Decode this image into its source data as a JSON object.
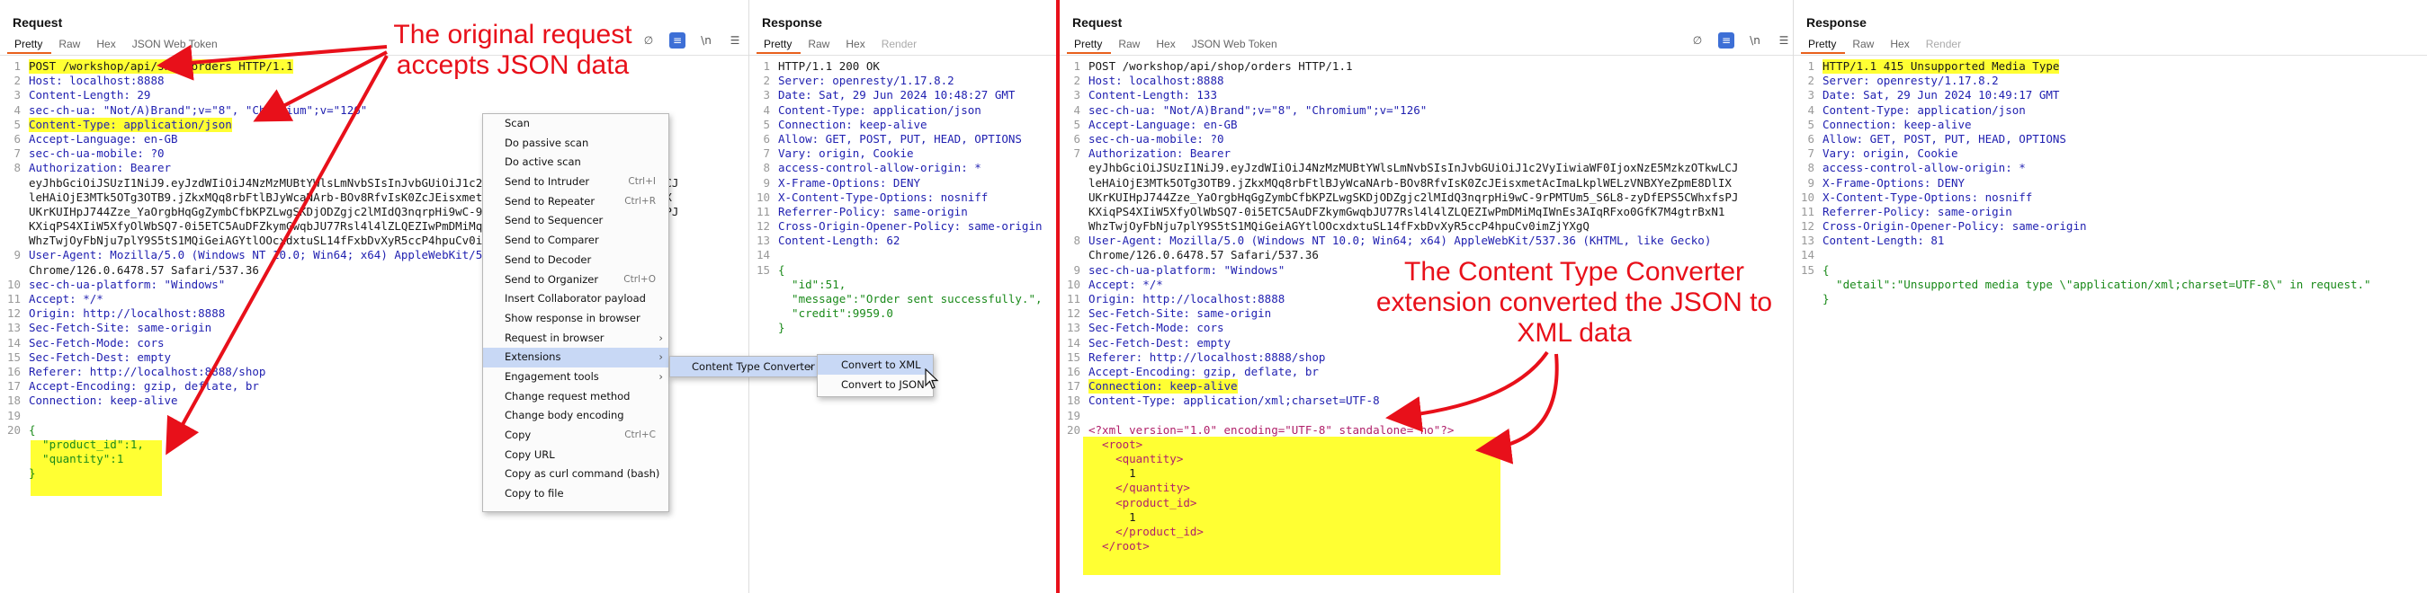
{
  "tabs": [
    "Pretty",
    "Raw",
    "Hex",
    "JSON Web Token"
  ],
  "tabs_short": [
    "Pretty",
    "Raw",
    "Hex",
    "Render"
  ],
  "left_request": {
    "title": "Request",
    "lines": [
      {
        "n": "1",
        "t": "POST /workshop/api/shop/orders HTTP/1.1"
      },
      {
        "n": "2",
        "t": "Host: localhost:8888"
      },
      {
        "n": "3",
        "t": "Content-Length: 29"
      },
      {
        "n": "4",
        "t": "sec-ch-ua: \"Not/A)Brand\";v=\"8\", \"Chromium\";v=\"126\""
      },
      {
        "n": "5",
        "t": "Content-Type: application/json"
      },
      {
        "n": "6",
        "t": "Accept-Language: en-GB"
      },
      {
        "n": "7",
        "t": "sec-ch-ua-mobile: ?0"
      },
      {
        "n": "8",
        "t": "Authorization: Bearer"
      },
      {
        "n": "",
        "t": "eyJhbGciOiJSUzI1NiJ9.eyJzdWIiOiJ4NzMzMUBtYWlsLmNvbSIsInJvbGUiOiJ1c2VyIiwiaWF0IjoxNzE5MzkzOTkwLCJ"
      },
      {
        "n": "",
        "t": "leHAiOjE3MTk5OTg3OTB9.jZkxMQq8rbFtlBJyWcaNArb-BOv8RfvIsK0ZcJEisxmetAcImaLkplWELzVNBXYeZpmE8DlIX"
      },
      {
        "n": "",
        "t": "UKrKUIHpJ744Zze_YaOrgbHqGgZymbCfbKPZLwgSKDjODZgjc2lMIdQ3nqrpHi9wC-9rPMTUm5_S6L8-zyDfEPS5CWhxfsPJ"
      },
      {
        "n": "",
        "t": "KXiqPS4XIiW5XfyOlWbSQ7-0i5ETC5AuDFZkymGwqbJU77Rsl4l4lZLQEZIwPmDMiMqIWnEs3AIqRFxo0GfK7M4gtrBxN1"
      },
      {
        "n": "",
        "t": "WhzTwjOyFbNju7plY9S5tS1MQiGeiAGYtlOOcxdxtuSL14fFxbDvXyR5ccP4hpuCv0imZjYXgQ"
      },
      {
        "n": "9",
        "t": "User-Agent: Mozilla/5.0 (Windows NT 10.0; Win64; x64) AppleWebKit/537.36 (KHTML, like Gecko)"
      },
      {
        "n": "",
        "t": "Chrome/126.0.6478.57 Safari/537.36"
      },
      {
        "n": "10",
        "t": "sec-ch-ua-platform: \"Windows\""
      },
      {
        "n": "11",
        "t": "Accept: */*"
      },
      {
        "n": "12",
        "t": "Origin: http://localhost:8888"
      },
      {
        "n": "13",
        "t": "Sec-Fetch-Site: same-origin"
      },
      {
        "n": "14",
        "t": "Sec-Fetch-Mode: cors"
      },
      {
        "n": "15",
        "t": "Sec-Fetch-Dest: empty"
      },
      {
        "n": "16",
        "t": "Referer: http://localhost:8888/shop"
      },
      {
        "n": "17",
        "t": "Accept-Encoding: gzip, deflate, br"
      },
      {
        "n": "18",
        "t": "Connection: keep-alive"
      },
      {
        "n": "19",
        "t": ""
      },
      {
        "n": "20",
        "t": "{"
      },
      {
        "n": "",
        "t": "  \"product_id\":1,"
      },
      {
        "n": "",
        "t": "  \"quantity\":1"
      },
      {
        "n": "",
        "t": "}"
      }
    ]
  },
  "left_response": {
    "title": "Response",
    "lines": [
      {
        "n": "1",
        "t": "HTTP/1.1 200 OK"
      },
      {
        "n": "2",
        "t": "Server: openresty/1.17.8.2"
      },
      {
        "n": "3",
        "t": "Date: Sat, 29 Jun 2024 10:48:27 GMT"
      },
      {
        "n": "4",
        "t": "Content-Type: application/json"
      },
      {
        "n": "5",
        "t": "Connection: keep-alive"
      },
      {
        "n": "6",
        "t": "Allow: GET, POST, PUT, HEAD, OPTIONS"
      },
      {
        "n": "7",
        "t": "Vary: origin, Cookie"
      },
      {
        "n": "8",
        "t": "access-control-allow-origin: *"
      },
      {
        "n": "9",
        "t": "X-Frame-Options: DENY"
      },
      {
        "n": "10",
        "t": "X-Content-Type-Options: nosniff"
      },
      {
        "n": "11",
        "t": "Referrer-Policy: same-origin"
      },
      {
        "n": "12",
        "t": "Cross-Origin-Opener-Policy: same-origin"
      },
      {
        "n": "13",
        "t": "Content-Length: 62"
      },
      {
        "n": "14",
        "t": ""
      },
      {
        "n": "15",
        "t": "{"
      },
      {
        "n": "",
        "t": "  \"id\":51,"
      },
      {
        "n": "",
        "t": "  \"message\":\"Order sent successfully.\","
      },
      {
        "n": "",
        "t": "  \"credit\":9959.0"
      },
      {
        "n": "",
        "t": "}"
      }
    ]
  },
  "right_request": {
    "title": "Request",
    "lines": [
      {
        "n": "1",
        "t": "POST /workshop/api/shop/orders HTTP/1.1"
      },
      {
        "n": "2",
        "t": "Host: localhost:8888"
      },
      {
        "n": "3",
        "t": "Content-Length: 133"
      },
      {
        "n": "4",
        "t": "sec-ch-ua: \"Not/A)Brand\";v=\"8\", \"Chromium\";v=\"126\""
      },
      {
        "n": "5",
        "t": "Accept-Language: en-GB"
      },
      {
        "n": "6",
        "t": "sec-ch-ua-mobile: ?0"
      },
      {
        "n": "7",
        "t": "Authorization: Bearer"
      },
      {
        "n": "",
        "t": "eyJhbGciOiJSUzI1NiJ9.eyJzdWIiOiJ4NzMzMUBtYWlsLmNvbSIsInJvbGUiOiJ1c2VyIiwiaWF0IjoxNzE5MzkzOTkwLCJ"
      },
      {
        "n": "",
        "t": "leHAiOjE3MTk5OTg3OTB9.jZkxMQq8rbFtlBJyWcaNArb-BOv8RfvIsK0ZcJEisxmetAcImaLkplWELzVNBXYeZpmE8DlIX"
      },
      {
        "n": "",
        "t": "UKrKUIHpJ744Zze_YaOrgbHqGgZymbCfbKPZLwgSKDjODZgjc2lMIdQ3nqrpHi9wC-9rPMTUm5_S6L8-zyDfEPS5CWhxfsPJ"
      },
      {
        "n": "",
        "t": "KXiqPS4XIiW5XfyOlWbSQ7-0i5ETC5AuDFZkymGwqbJU77Rsl4l4lZLQEZIwPmDMiMqIWnEs3AIqRFxo0GfK7M4gtrBxN1"
      },
      {
        "n": "",
        "t": "WhzTwjOyFbNju7plY9S5tS1MQiGeiAGYtlOOcxdxtuSL14fFxbDvXyR5ccP4hpuCv0imZjYXgQ"
      },
      {
        "n": "8",
        "t": "User-Agent: Mozilla/5.0 (Windows NT 10.0; Win64; x64) AppleWebKit/537.36 (KHTML, like Gecko)"
      },
      {
        "n": "",
        "t": "Chrome/126.0.6478.57 Safari/537.36"
      },
      {
        "n": "9",
        "t": "sec-ch-ua-platform: \"Windows\""
      },
      {
        "n": "10",
        "t": "Accept: */*"
      },
      {
        "n": "11",
        "t": "Origin: http://localhost:8888"
      },
      {
        "n": "12",
        "t": "Sec-Fetch-Site: same-origin"
      },
      {
        "n": "13",
        "t": "Sec-Fetch-Mode: cors"
      },
      {
        "n": "14",
        "t": "Sec-Fetch-Dest: empty"
      },
      {
        "n": "15",
        "t": "Referer: http://localhost:8888/shop"
      },
      {
        "n": "16",
        "t": "Accept-Encoding: gzip, deflate, br"
      },
      {
        "n": "17",
        "t": "Connection: keep-alive"
      },
      {
        "n": "18",
        "t": "Content-Type: application/xml;charset=UTF-8"
      },
      {
        "n": "19",
        "t": ""
      },
      {
        "n": "20",
        "t": "<?xml version=\"1.0\" encoding=\"UTF-8\" standalone=\"no\"?>"
      },
      {
        "n": "",
        "t": "  <root>"
      },
      {
        "n": "",
        "t": "    <quantity>"
      },
      {
        "n": "",
        "t": "      1"
      },
      {
        "n": "",
        "t": "    </quantity>"
      },
      {
        "n": "",
        "t": "    <product_id>"
      },
      {
        "n": "",
        "t": "      1"
      },
      {
        "n": "",
        "t": "    </product_id>"
      },
      {
        "n": "",
        "t": "  </root>"
      }
    ]
  },
  "right_response": {
    "title": "Response",
    "lines": [
      {
        "n": "1",
        "t": "HTTP/1.1 415 Unsupported Media Type"
      },
      {
        "n": "2",
        "t": "Server: openresty/1.17.8.2"
      },
      {
        "n": "3",
        "t": "Date: Sat, 29 Jun 2024 10:49:17 GMT"
      },
      {
        "n": "4",
        "t": "Content-Type: application/json"
      },
      {
        "n": "5",
        "t": "Connection: keep-alive"
      },
      {
        "n": "6",
        "t": "Allow: GET, POST, PUT, HEAD, OPTIONS"
      },
      {
        "n": "7",
        "t": "Vary: origin, Cookie"
      },
      {
        "n": "8",
        "t": "access-control-allow-origin: *"
      },
      {
        "n": "9",
        "t": "X-Frame-Options: DENY"
      },
      {
        "n": "10",
        "t": "X-Content-Type-Options: nosniff"
      },
      {
        "n": "11",
        "t": "Referrer-Policy: same-origin"
      },
      {
        "n": "12",
        "t": "Cross-Origin-Opener-Policy: same-origin"
      },
      {
        "n": "13",
        "t": "Content-Length: 81"
      },
      {
        "n": "14",
        "t": ""
      },
      {
        "n": "15",
        "t": "{"
      },
      {
        "n": "",
        "t": "  \"detail\":\"Unsupported media type \\\"application/xml;charset=UTF-8\\\" in request.\""
      },
      {
        "n": "",
        "t": "}"
      }
    ]
  },
  "context_menu": {
    "items": [
      {
        "label": "Scan",
        "shortcut": "",
        "sub": false
      },
      {
        "label": "Do passive scan",
        "shortcut": "",
        "sub": false
      },
      {
        "label": "Do active scan",
        "shortcut": "",
        "sub": false
      },
      {
        "label": "Send to Intruder",
        "shortcut": "Ctrl+I",
        "sub": false
      },
      {
        "label": "Send to Repeater",
        "shortcut": "Ctrl+R",
        "sub": false
      },
      {
        "label": "Send to Sequencer",
        "shortcut": "",
        "sub": false
      },
      {
        "label": "Send to Comparer",
        "shortcut": "",
        "sub": false
      },
      {
        "label": "Send to Decoder",
        "shortcut": "",
        "sub": false
      },
      {
        "label": "Send to Organizer",
        "shortcut": "Ctrl+O",
        "sub": false
      },
      {
        "label": "Insert Collaborator payload",
        "shortcut": "",
        "sub": false
      },
      {
        "label": "Show response in browser",
        "shortcut": "",
        "sub": false
      },
      {
        "label": "Request in browser",
        "shortcut": "",
        "sub": true
      },
      {
        "label": "Extensions",
        "shortcut": "",
        "sub": true
      },
      {
        "label": "Engagement tools",
        "shortcut": "",
        "sub": true
      },
      {
        "label": "Change request method",
        "shortcut": "",
        "sub": false
      },
      {
        "label": "Change body encoding",
        "shortcut": "",
        "sub": false
      },
      {
        "label": "Copy",
        "shortcut": "Ctrl+C",
        "sub": false
      },
      {
        "label": "Copy URL",
        "shortcut": "",
        "sub": false
      },
      {
        "label": "Copy as curl command (bash)",
        "shortcut": "",
        "sub": false
      },
      {
        "label": "Copy to file",
        "shortcut": "",
        "sub": false
      }
    ],
    "submenu_label": "Content Type Converter",
    "submenu2": [
      "Convert to XML",
      "Convert to JSON"
    ]
  },
  "annotations": {
    "a1": "The original request accepts JSON data",
    "a2": "The Content Type Converter extension converted the JSON to XML data"
  },
  "toolbar_glyphs": [
    "∅",
    "≡",
    "\\n",
    "☰"
  ],
  "colors": {
    "highlight": "#ffff33",
    "annotation": "#e8101a",
    "accent": "#e8601c",
    "selection": "#c8d8f5"
  }
}
